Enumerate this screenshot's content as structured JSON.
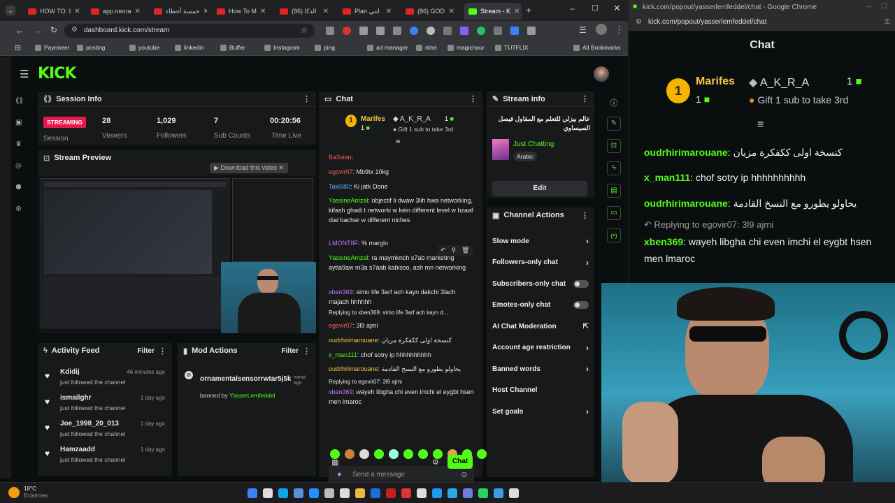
{
  "tabs": [
    {
      "label": "HOW TO: I",
      "active": false
    },
    {
      "label": "app.neora",
      "active": false
    },
    {
      "label": "خمسة أخطاء",
      "active": false
    },
    {
      "label": "How To M",
      "active": false
    },
    {
      "label": "(86) الذكا",
      "active": false
    },
    {
      "label": "Plan انتي",
      "active": false
    },
    {
      "label": "(86) GOD",
      "active": false
    },
    {
      "label": "Stream - K",
      "active": true
    }
  ],
  "url": "dashboard.kick.com/stream",
  "bookmarks": [
    "Payoneer",
    "posting",
    "youtube",
    "linkedin",
    "Buffer",
    "Instagram",
    "ping",
    "ad manager",
    "rkha",
    "magichour",
    "TUTFLIX",
    "All Bookmarks"
  ],
  "session": {
    "title": "Session Info",
    "status": "STREAMING",
    "status_label": "Session",
    "viewers": "28",
    "viewers_label": "Viewers",
    "followers": "1,029",
    "followers_label": "Followers",
    "subs": "7",
    "subs_label": "Sub Counts",
    "time": "00:20:56",
    "time_label": "Time Live"
  },
  "preview": {
    "title": "Stream Preview",
    "download": "Download this video"
  },
  "activity": {
    "title": "Activity Feed",
    "filter": "Filter",
    "items": [
      {
        "name": "Kdidij",
        "action": "just followed the channel",
        "time": "46 minutes ago"
      },
      {
        "name": "ismailghr",
        "action": "just followed the channel",
        "time": "1 day ago"
      },
      {
        "name": "Joe_1998_20_013",
        "action": "just followed the channel",
        "time": "1 day ago"
      },
      {
        "name": "Hamzaadd",
        "action": "just followed the channel",
        "time": "1 day ago"
      }
    ]
  },
  "mod": {
    "title": "Mod Actions",
    "filter": "Filter",
    "user": "ornamentalsensorrwtar5j5k",
    "time": "minut ago",
    "banned_by": "banned by",
    "moderator": "YasserLemfeddel"
  },
  "chat": {
    "title": "Chat",
    "leader1": "Marifes",
    "leader1_rank": "1",
    "leader1_count": "1",
    "leader2": "A_K_R_A",
    "leader2_count": "1",
    "leader3": "Gift 1 sub to take 3rd",
    "lines": [
      {
        "user": "Ba3sian",
        "color": "#ff5a5a",
        "text": ":"
      },
      {
        "user": "egovir07",
        "color": "#ff5a5a",
        "text": ": Mb9tx 10kg"
      },
      {
        "user": "Taki580",
        "color": "#5ab0ff",
        "text": ": Ki jatk Done"
      },
      {
        "user": "YassineAmzal",
        "color": "#53fc18",
        "text": ": objectif li dwaw 3lih hwa networking, kifash ghadi t networki w kein different level w bzaaf dial bachar w different niches"
      },
      {
        "user": "LMONTIIF",
        "color": "#c678ff",
        "text": ": % margin"
      },
      {
        "user": "YassineAmzal",
        "color": "#53fc18",
        "text": ": ra maymknch s7ab marketing aytla9aw m3a s7aab kabisso, ash mn networking"
      },
      {
        "user": "xben369",
        "color": "#c678ff",
        "text": ": simo life 3arf ach kayn dakchi 3lach majach hhhhhh"
      },
      {
        "user": "egovir07",
        "color": "#ff5a5a",
        "text": ": 3l9 ajmi"
      },
      {
        "user": "oudrhirimarouane",
        "color": "#f5c542",
        "text": ": كنسخة اولى ككفكرة مزيان"
      },
      {
        "user": "x_man111",
        "color": "#53fc18",
        "text": ": chof sotry ip hhhhhhhhhh"
      },
      {
        "user": "oudrhirimarouane",
        "color": "#f5c542",
        "text": ": يحاولو يطورو مع النسخ القادمة"
      },
      {
        "user": "xben369",
        "color": "#c678ff",
        "text": ": wayeh libgha chi even imchi el eygbt hsen men lmaroc"
      }
    ],
    "reply1": "Replying to xben369: simo life 3arf ach kayn d...",
    "reply2": "Replying to egovir07: 3l9 ajmi",
    "placeholder": "Send a message",
    "send": "Chat"
  },
  "streaminfo": {
    "title": "Stream info",
    "name": "عالم بيزلي للتعلم مع المقاول فيصل السيساوي",
    "category": "Just Chatting",
    "tag": "Arabic",
    "edit": "Edit"
  },
  "channel": {
    "title": "Channel Actions",
    "items": [
      {
        "label": "Slow mode",
        "type": "arrow"
      },
      {
        "label": "Followers-only chat",
        "type": "arrow"
      },
      {
        "label": "Subscribers-only chat",
        "type": "toggle"
      },
      {
        "label": "Emotes-only chat",
        "type": "toggle"
      },
      {
        "label": "AI Chat Moderation",
        "type": "ext"
      },
      {
        "label": "Account age restriction",
        "type": "arrow"
      },
      {
        "label": "Banned words",
        "type": "arrow"
      },
      {
        "label": "Host Channel",
        "type": "none"
      },
      {
        "label": "Set goals",
        "type": "arrow"
      }
    ]
  },
  "popout": {
    "titlebar": "kick.com/popout/yasserlemfeddel/chat - Google Chrome",
    "url": "kick.com/popout/yasserlemfeddel/chat",
    "title": "Chat",
    "leader1": "Marifes",
    "leader1_count": "1",
    "leader2": "A_K_R_A",
    "leader2_count": "1",
    "leader3": "Gift 1 sub to take 3rd",
    "lines": [
      {
        "user": "oudrhirimarouane",
        "color": "#53fc18",
        "text": ": كنسخة اولى ككفكرة مزيان"
      },
      {
        "user": "x_man111",
        "color": "#53fc18",
        "text": ": chof sotry ip hhhhhhhhhh"
      },
      {
        "user": "oudrhirimarouane",
        "color": "#53fc18",
        "text": ": يحاولو يطورو مع النسخ القادمة"
      }
    ],
    "reply": "Replying to egovir07: 3l9 ajmi",
    "last_user": "xben369",
    "last_text": ": wayeh libgha chi even imchi el eygbt hsen men lmaroc"
  },
  "weather": {
    "temp": "18°C",
    "desc": "Eclaircies"
  }
}
